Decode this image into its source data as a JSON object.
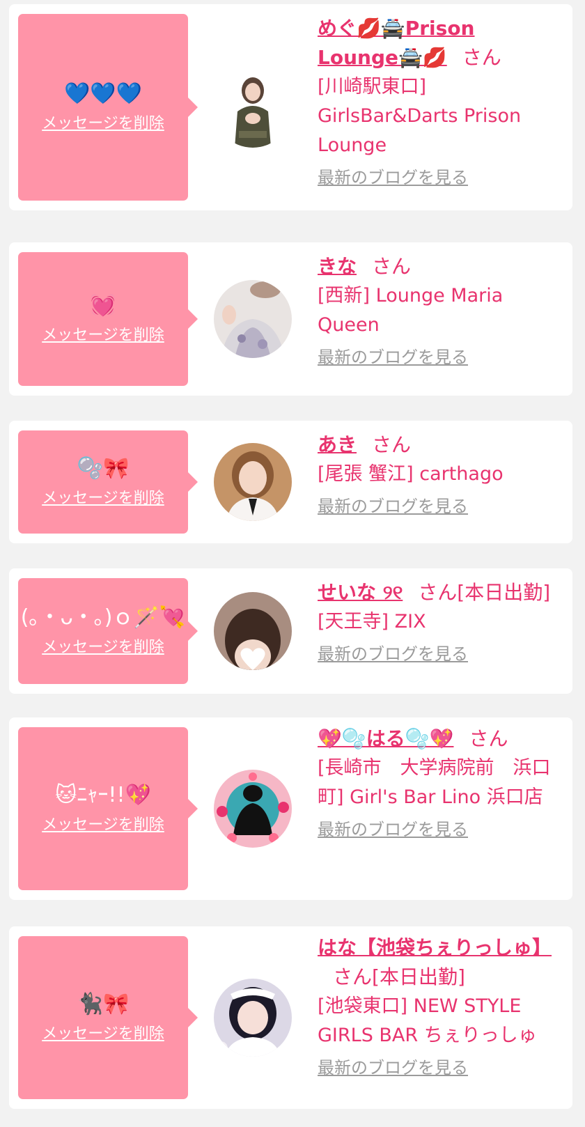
{
  "entries": [
    {
      "message": "💙💙💙",
      "delete_label": "メッセージを削除",
      "name": "めぐ💋🚔Prison Lounge🚔💋",
      "honorific": "さん",
      "badge": "",
      "shop": "[川崎駅東口] GirlsBar&Darts Prison Lounge",
      "blog_label": "最新のブログを見る"
    },
    {
      "message": "💓",
      "delete_label": "メッセージを削除",
      "name": "きな",
      "honorific": "さん",
      "badge": "",
      "shop": "[西新] Lounge Maria Queen",
      "blog_label": "最新のブログを見る"
    },
    {
      "message": "🫧🎀",
      "delete_label": "メッセージを削除",
      "name": "あき",
      "honorific": "さん",
      "badge": "",
      "shop": "[尾張 蟹江] carthago",
      "blog_label": "最新のブログを見る"
    },
    {
      "message": "(｡・ᴗ・｡)ｏ🪄💘",
      "delete_label": "メッセージを削除",
      "name": "せいな ୨୧",
      "honorific": "さん",
      "badge": "[本日出勤]",
      "shop": "[天王寺] ZIX",
      "blog_label": "最新のブログを見る"
    },
    {
      "message": "🐱ﾆｬｰ!!💖",
      "delete_label": "メッセージを削除",
      "name": "💖🫧はる🫧💖",
      "honorific": "さん",
      "badge": "",
      "shop": "[長崎市　大学病院前　浜口町] Girl's Bar Lino 浜口店",
      "blog_label": "最新のブログを見る"
    },
    {
      "message": "🐈‍⬛🎀",
      "delete_label": "メッセージを削除",
      "name": "はな【池袋ちぇりっしゅ】",
      "honorific": "さん",
      "badge": "[本日出勤]",
      "shop": "[池袋東口] NEW STYLE GIRLS BAR ちぇりっしゅ",
      "blog_label": "最新のブログを見る"
    }
  ],
  "colors": {
    "accent": "#e8336e",
    "bubble": "#ff94a8",
    "link_gray": "#9b9b9b",
    "background": "#f2f2f2"
  }
}
